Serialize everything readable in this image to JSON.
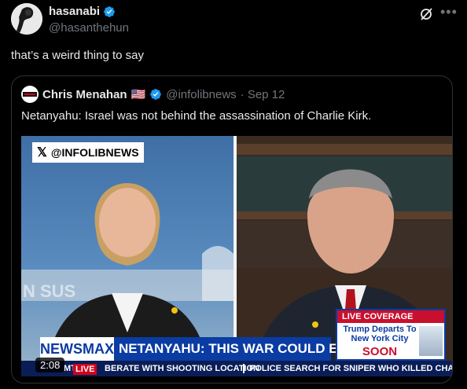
{
  "post": {
    "name": "hasanabi",
    "handle": "@hasanthehun",
    "text": "that’s a weird thing to say"
  },
  "quote": {
    "name": "Chris Menahan",
    "flag": "🇺🇸",
    "handle": "@infolibnews",
    "date": "· Sep 12",
    "text": "Netanyahu: Israel was not behind the assassination of Charlie Kirk."
  },
  "video": {
    "watermark": "@INFOLIBNEWS",
    "network": "NEWSMAX",
    "headline": "NETANYAHU: THIS WAR COULD END NOW",
    "timestamp": "2:08",
    "ticker_prefix": "MT",
    "ticker_live": "LIVE",
    "ticker_1": "BERATE WITH SHOOTING LOCATION",
    "ticker_2": "POLICE SEARCH FOR SNIPER WHO KILLED CHARLIE KI",
    "live_box": {
      "header": "LIVE COVERAGE",
      "subtitle": "Trump Departs To New York City",
      "soon": "SOON"
    },
    "backdrop_text": "N SUS"
  },
  "colors": {
    "accent_blue": "#1d9bf0",
    "muted": "#71767b",
    "newsmax_blue": "#0a3ca3",
    "live_red": "#c8102e"
  }
}
